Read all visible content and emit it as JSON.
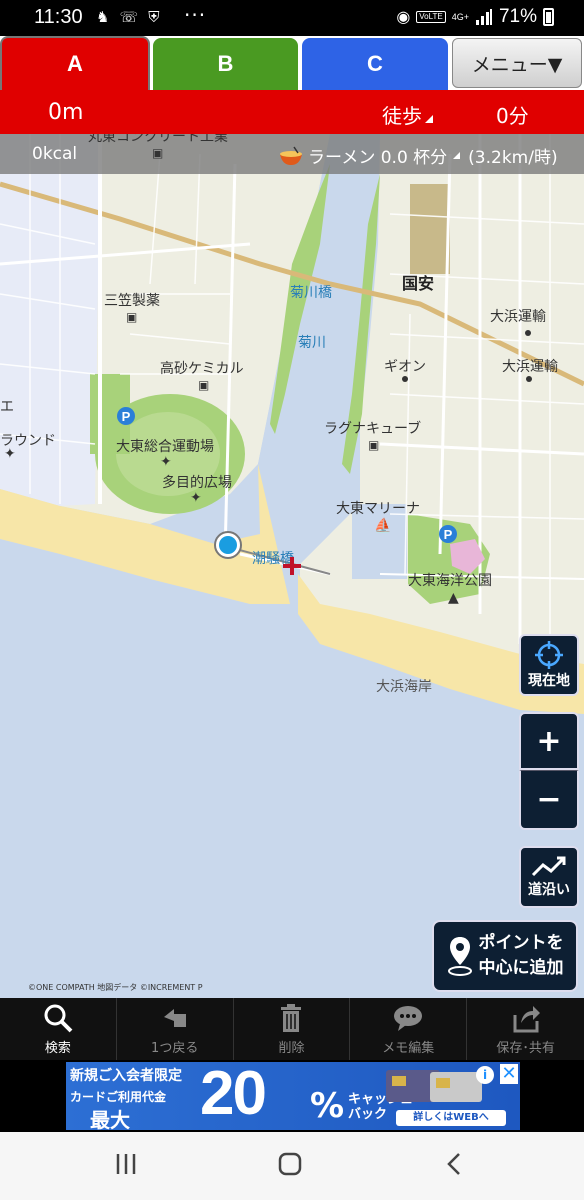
{
  "status_bar": {
    "time": "11:30",
    "dots": "···",
    "volte": "VoLTE",
    "network": "4G+",
    "battery_pct": "71%"
  },
  "tabs": [
    {
      "label": "A",
      "color": "#e00000",
      "active": true
    },
    {
      "label": "B",
      "color": "#4a9a22",
      "active": false
    },
    {
      "label": "C",
      "color": "#2e63e6",
      "active": false
    }
  ],
  "menu_label": "メニュー▼",
  "route_info": {
    "distance": "0m",
    "mode": "徒歩",
    "duration": "0分"
  },
  "calorie_info": {
    "kcal": "0kcal",
    "ramen": "ラーメン 0.0 杯分",
    "speed": "(3.2km/時)"
  },
  "map": {
    "labels": {
      "concrete": "丸東コンクリート工業",
      "kokuan": "国安",
      "kikugawa_bridge": "菊川橋",
      "kikugawa": "菊川",
      "mikasa": "三笠製薬",
      "ohama_unyu1": "大浜運輸",
      "ohama_unyu2": "大浜運輸",
      "gion": "ギオン",
      "takasago": "高砂ケミカル",
      "ground": "ラウンド",
      "laguna": "ラグナキューブ",
      "daito_sports": "大東総合運動場",
      "tamokuteki": "多目的広場",
      "marina": "大東マリーナ",
      "shiosai": "潮騒橋",
      "kaiyo_park": "大東海洋公園",
      "ohama_beach": "大浜海岸",
      "edge_e": "エ"
    },
    "copyright": "©ONE COMPATH 地図データ ©INCREMENT P",
    "buttons": {
      "current_location": "現在地",
      "zoom_in": "+",
      "zoom_out": "−",
      "along_road": "道沿い",
      "add_point_line1": "ポイントを",
      "add_point_line2": "中心に追加"
    }
  },
  "toolbar": [
    {
      "label": "検索",
      "icon": "search-icon",
      "enabled": true
    },
    {
      "label": "1つ戻る",
      "icon": "undo-icon",
      "enabled": false
    },
    {
      "label": "削除",
      "icon": "trash-icon",
      "enabled": false
    },
    {
      "label": "メモ編集",
      "icon": "memo-icon",
      "enabled": false
    },
    {
      "label": "保存･共有",
      "icon": "share-icon",
      "enabled": false
    }
  ],
  "ad": {
    "line1": "新規ご入会者限定",
    "line2": "カードご利用代金",
    "line3": "最大",
    "big": "20",
    "pct": "%",
    "cash1": "キャッシュ",
    "cash2": "バック",
    "web": "詳しくはWEBへ",
    "info": "i",
    "close": "✕"
  }
}
